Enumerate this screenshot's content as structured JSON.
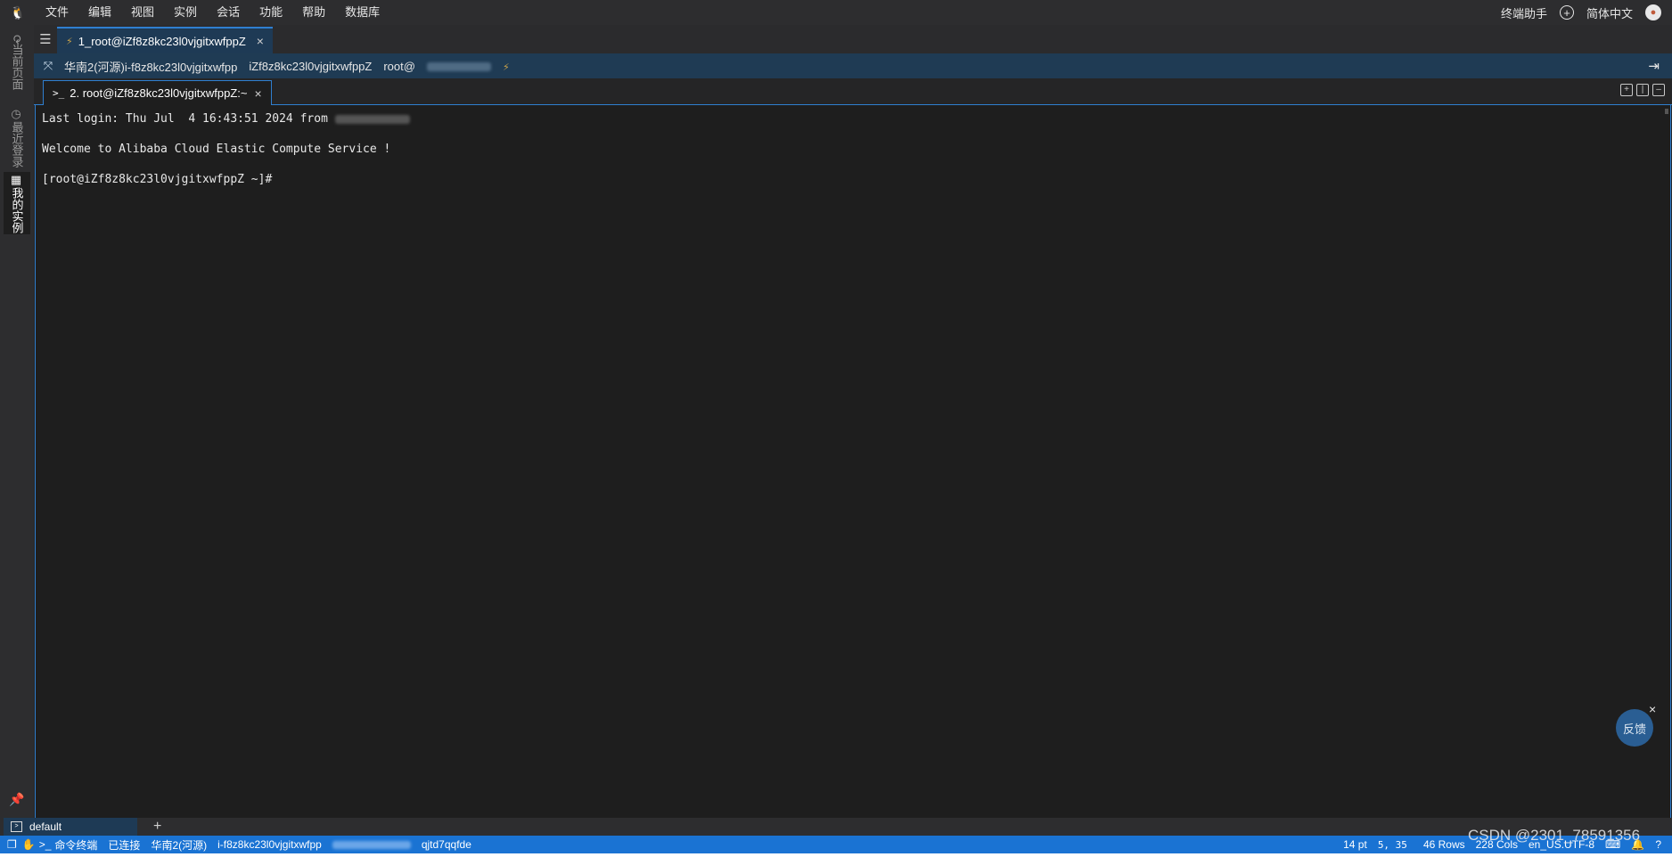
{
  "menubar": {
    "items": [
      "文件",
      "编辑",
      "视图",
      "实例",
      "会话",
      "功能",
      "帮助",
      "数据库"
    ],
    "assistant": "终端助手",
    "language": "简体中文"
  },
  "sidebar": {
    "tabs": [
      {
        "label": "当前页面",
        "icon": "refresh-icon"
      },
      {
        "label": "最近登录",
        "icon": "clock-icon"
      },
      {
        "label": "我的实例",
        "icon": "server-icon"
      }
    ]
  },
  "session_tab": {
    "label": "1_root@iZf8z8kc23l0vjgitxwfppZ"
  },
  "infobar": {
    "region_instance": "华南2(河源)i-f8z8kc23l0vjgitxwfpp",
    "hostname": "iZf8z8kc23l0vjgitxwfppZ",
    "user_prefix": "root@"
  },
  "terminal_tab": {
    "label": "2. root@iZf8z8kc23l0vjgitxwfppZ:~"
  },
  "terminal": {
    "lines": {
      "last_login": "Last login: Thu Jul  4 16:43:51 2024 from ",
      "welcome": "Welcome to Alibaba Cloud Elastic Compute Service !",
      "prompt": "[root@iZf8z8kc23l0vjgitxwfppZ ~]#"
    }
  },
  "feedback": {
    "label": "反馈"
  },
  "bottom_tabs": {
    "default_label": "default",
    "add": "+"
  },
  "statusbar": {
    "command_terminal": "命令终端",
    "connection_status": "已连接",
    "region": "华南2(河源)",
    "instance_id": "i-f8z8kc23l0vjgitxwfpp",
    "session_id": "qjtd7qqfde",
    "font_size": "14 pt",
    "cursor_pos": "5, 35",
    "rows": "46 Rows",
    "cols": "228 Cols",
    "encoding": "en_US.UTF-8"
  },
  "watermark": "CSDN @2301_78591356"
}
